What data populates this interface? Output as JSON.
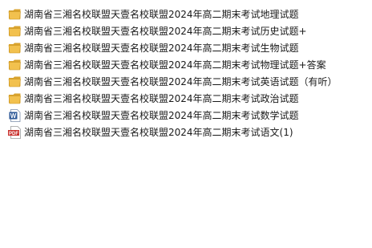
{
  "files": [
    {
      "name": "湖南省三湘名校联盟天壹名校联盟2024年高二期末考试地理试题",
      "icon": "folder-icon"
    },
    {
      "name": "湖南省三湘名校联盟天壹名校联盟2024年高二期末考试历史试题+",
      "icon": "folder-icon"
    },
    {
      "name": "湖南省三湘名校联盟天壹名校联盟2024年高二期末考试生物试题",
      "icon": "folder-icon"
    },
    {
      "name": "湖南省三湘名校联盟天壹名校联盟2024年高二期末考试物理试题+答案",
      "icon": "folder-icon"
    },
    {
      "name": "湖南省三湘名校联盟天壹名校联盟2024年高二期末考试英语试题（有听）",
      "icon": "folder-icon"
    },
    {
      "name": "湖南省三湘名校联盟天壹名校联盟2024年高二期末考试政治试题",
      "icon": "folder-icon"
    },
    {
      "name": "湖南省三湘名校联盟天壹名校联盟2024年高二期末考试数学试题",
      "icon": "word-document-icon"
    },
    {
      "name": "湖南省三湘名校联盟天壹名校联盟2024年高二期末考试语文(1)",
      "icon": "pdf-document-icon"
    }
  ],
  "icon_labels": {
    "pdf": "PDF",
    "word": "W"
  },
  "colors": {
    "folder_body": "#F2C14E",
    "folder_tab": "#D9A32E",
    "word_blue": "#2B5797",
    "pdf_red": "#C9302C"
  }
}
